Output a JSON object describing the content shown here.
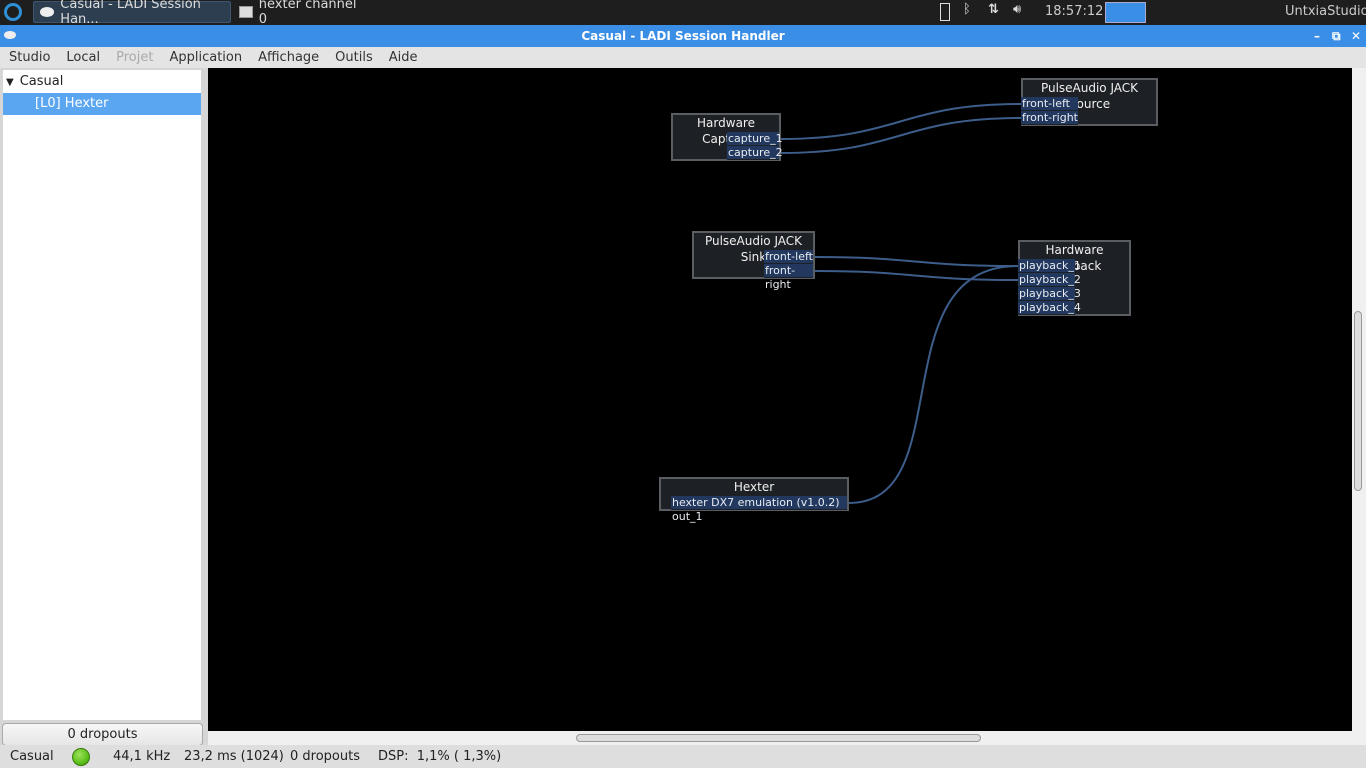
{
  "taskbar": {
    "tasks": [
      {
        "label": "Casual - LADI Session Han..."
      },
      {
        "label": "hexter channel 0"
      }
    ],
    "clock": "18:57:12",
    "user": "UntxiaStudio",
    "tray_icons": [
      "battery-icon",
      "bluetooth-icon",
      "network-icon",
      "volume-icon"
    ]
  },
  "window": {
    "title": "Casual - LADI Session Handler"
  },
  "menu": [
    "Studio",
    "Local",
    "Projet",
    "Application",
    "Affichage",
    "Outils",
    "Aide"
  ],
  "tree": {
    "root": "Casual",
    "items": [
      "[L0] Hexter"
    ]
  },
  "dropout_button": "0 dropouts",
  "canvas": {
    "nodes": [
      {
        "title": "Hardware Capture",
        "ports": [
          "capture_1",
          "capture_2"
        ]
      },
      {
        "title": "PulseAudio JACK Source",
        "ports": [
          "front-left",
          "front-right"
        ]
      },
      {
        "title": "PulseAudio JACK Sink",
        "ports": [
          "front-left",
          "front-right"
        ]
      },
      {
        "title": "Hardware Playback",
        "ports": [
          "playback_1",
          "playback_2",
          "playback_3",
          "playback_4"
        ]
      },
      {
        "title": "Hexter",
        "ports": [
          "hexter DX7 emulation (v1.0.2) out_1"
        ]
      }
    ],
    "connections": [
      [
        "capture_1",
        "front-left"
      ],
      [
        "capture_2",
        "front-right"
      ],
      [
        "front-left",
        "playback_1"
      ],
      [
        "front-right",
        "playback_2"
      ],
      [
        "hexter DX7 emulation (v1.0.2) out_1",
        "playback_1"
      ]
    ]
  },
  "status": {
    "studio": "Casual",
    "sample_rate": "44,1 kHz",
    "latency": "23,2 ms (1024)",
    "dropouts": "0 dropouts",
    "dsp": "DSP:  1,1% ( 1,3%)",
    "server_state_color": "#5cc01a"
  }
}
